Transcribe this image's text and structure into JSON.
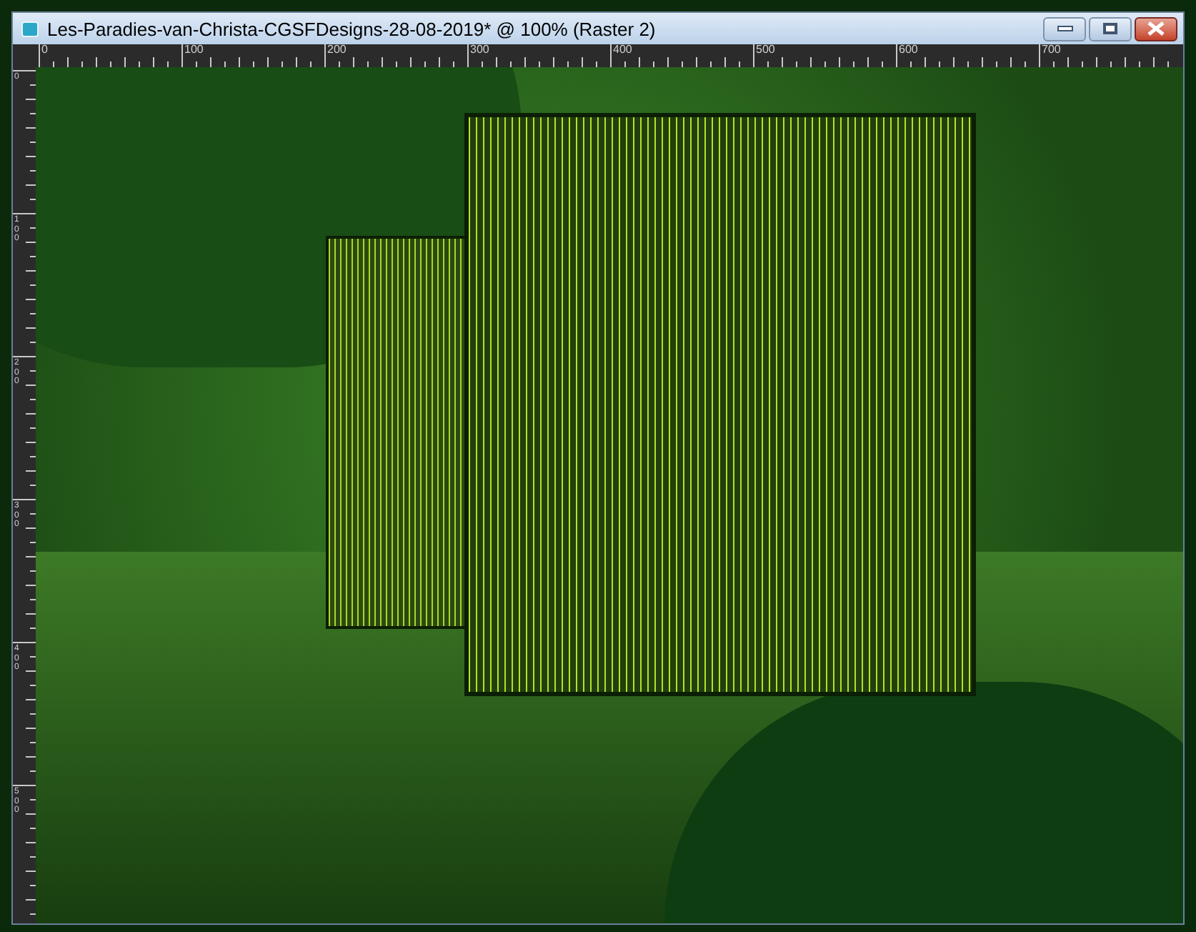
{
  "window": {
    "title": "Les-Paradies-van-Christa-CGSFDesigns-28-08-2019* @ 100% (Raster 2)"
  },
  "horizontal_ruler": {
    "labels": [
      "0",
      "100",
      "200",
      "300",
      "400",
      "500",
      "600",
      "700"
    ]
  },
  "vertical_ruler": {
    "labels": [
      "0",
      "100",
      "200",
      "300",
      "400",
      "500"
    ]
  }
}
